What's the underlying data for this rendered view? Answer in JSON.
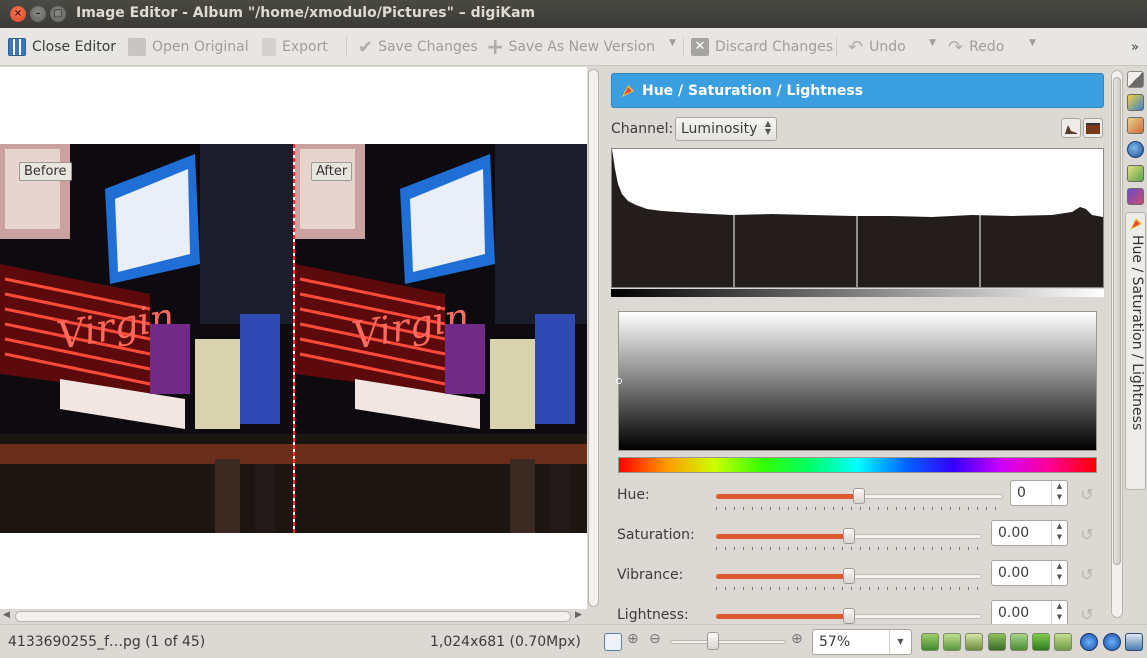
{
  "window": {
    "title": "Image Editor - Album \"/home/xmodulo/Pictures\" – digiKam",
    "close_glyph": "×",
    "min_glyph": "–",
    "max_glyph": "□"
  },
  "toolbar": {
    "close_editor": "Close Editor",
    "open_original": "Open Original",
    "export": "Export",
    "save_changes": "Save Changes",
    "save_as_new_version": "Save As New Version",
    "discard_changes": "Discard Changes",
    "undo": "Undo",
    "redo": "Redo",
    "overflow": "»"
  },
  "canvas": {
    "before_label": "Before",
    "after_label": "After"
  },
  "tool_panel": {
    "header_title": "Hue / Saturation / Lightness",
    "channel_label": "Channel:",
    "channel_value": "Luminosity",
    "hue": {
      "label": "Hue:",
      "value": "0",
      "position": 0.5
    },
    "saturation": {
      "label": "Saturation:",
      "value": "0.00",
      "position": 0.5
    },
    "vibrance": {
      "label": "Vibrance:",
      "value": "0.00",
      "position": 0.5
    },
    "lightness": {
      "label": "Lightness:",
      "value": "0.00",
      "position": 0.5
    }
  },
  "right_sidebar": {
    "active_tab": "Hue / Saturation / Lightness"
  },
  "status_bar": {
    "filename": "4133690255_f…pg (1 of 45)",
    "dimensions": "1,024x681 (0.70Mpx)",
    "zoom_value": "57%"
  },
  "colors": {
    "accent": "#3b9ee0",
    "slider_fill": "#e05a2f",
    "split_line": "#ff2a2a"
  }
}
